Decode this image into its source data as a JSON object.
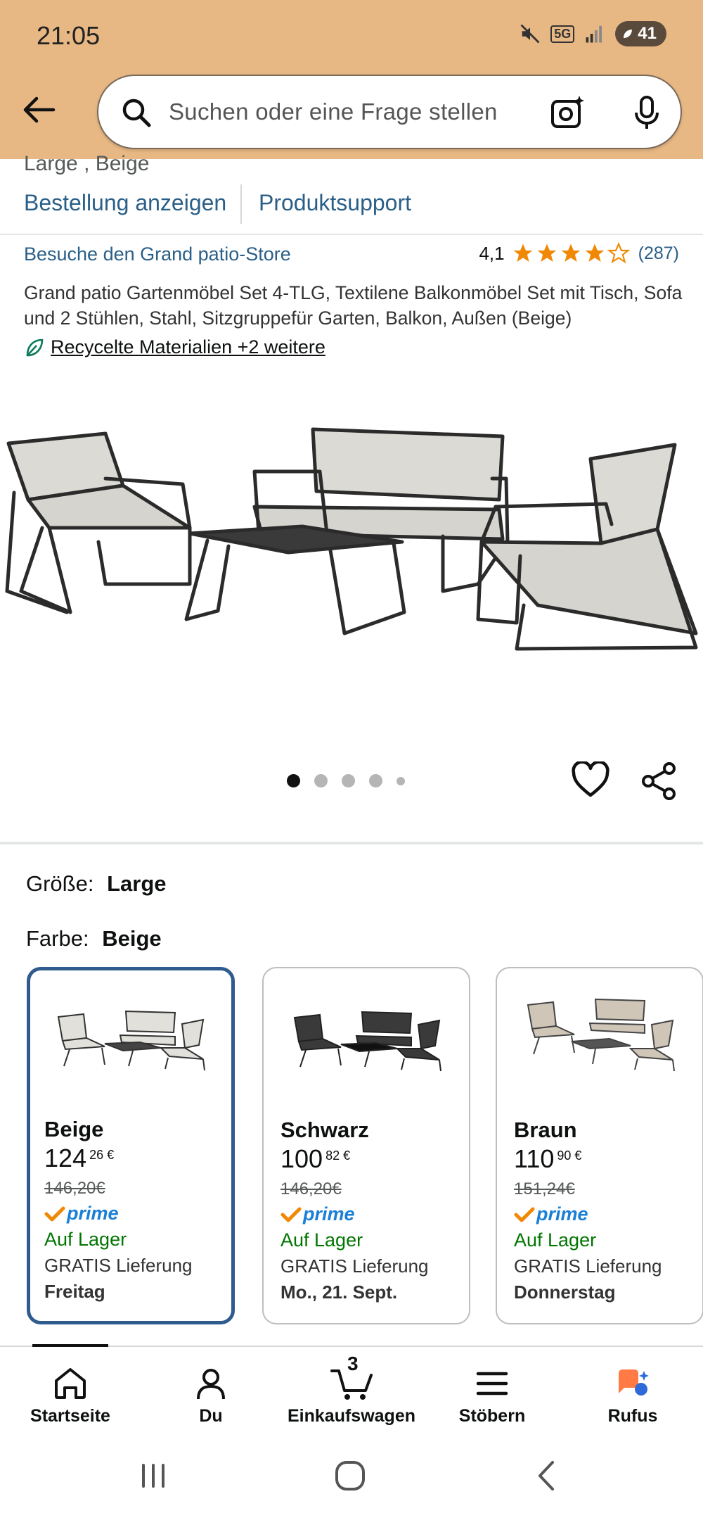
{
  "status_bar": {
    "time": "21:05",
    "network": "5G",
    "battery": "41"
  },
  "search": {
    "placeholder": "Suchen oder eine Frage stellen"
  },
  "order_bar": {
    "previous_variant": "Large , Beige",
    "view_order": "Bestellung anzeigen",
    "product_support": "Produktsupport"
  },
  "product": {
    "store": "Besuche den Grand patio-Store",
    "rating": "4,1",
    "rating_stars": 4.1,
    "rating_count": "(287)",
    "title": "Grand patio Gartenmöbel Set 4-TLG, Textilene Balkonmöbel Set mit Tisch, Sofa und 2 Stühlen, Stahl, Sitzgruppefür Garten, Balkon, Außen (Beige)",
    "sustainability": "Recycelte Materialien +2 weitere",
    "image_count": 5,
    "active_image": 1
  },
  "variations": {
    "size_label": "Größe:",
    "size_value": "Large",
    "color_label": "Farbe:",
    "color_value": "Beige",
    "options": [
      {
        "name": "Beige",
        "price_whole": "124",
        "price_cents": "26 €",
        "old_price": "146,20€",
        "prime": "prime",
        "stock": "Auf Lager",
        "delivery": "GRATIS Lieferung",
        "day": "Freitag",
        "selected": true
      },
      {
        "name": "Schwarz",
        "price_whole": "100",
        "price_cents": "82 €",
        "old_price": "146,20€",
        "prime": "prime",
        "stock": "Auf Lager",
        "delivery": "GRATIS Lieferung",
        "day": "Mo., 21. Sept.",
        "selected": false
      },
      {
        "name": "Braun",
        "price_whole": "110",
        "price_cents": "90 €",
        "old_price": "151,24€",
        "prime": "prime",
        "stock": "Auf Lager",
        "delivery": "GRATIS Lieferung",
        "day": "Donnerstag",
        "selected": false
      }
    ]
  },
  "bottom_nav": {
    "home": "Startseite",
    "you": "Du",
    "cart": "Einkaufswagen",
    "cart_count": "3",
    "browse": "Stöbern",
    "rufus": "Rufus"
  },
  "colors": {
    "header_bg": "#e8b884",
    "link": "#2a5f88",
    "star": "#f08804",
    "prime_blue": "#1a7fd6",
    "stock_green": "#007600",
    "selected_border": "#2f5b8e"
  },
  "icons": [
    "back-arrow-icon",
    "search-icon",
    "camera-lens-icon",
    "microphone-icon",
    "leaf-icon",
    "heart-icon",
    "share-icon",
    "home-icon",
    "user-icon",
    "cart-icon",
    "menu-icon",
    "rufus-icon"
  ]
}
